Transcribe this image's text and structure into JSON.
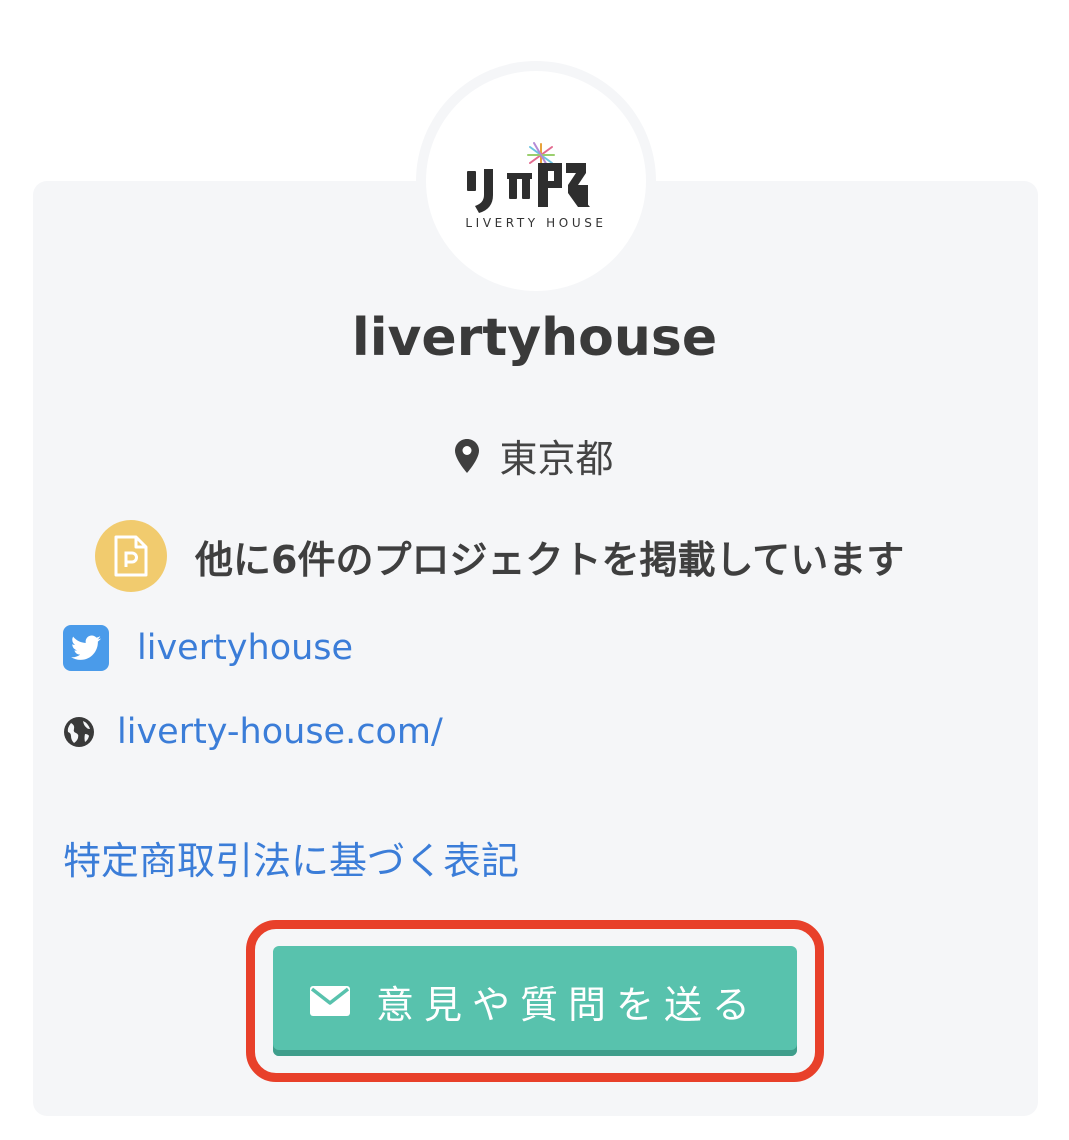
{
  "profile": {
    "avatar_logo_text": "LIVERTY HOUSE",
    "username": "livertyhouse",
    "location": "東京都",
    "projects_text": "他に6件のプロジェクトを掲載しています",
    "twitter_handle": "livertyhouse",
    "website": "liverty-house.com/",
    "law_link": "特定商取引法に基づく表記",
    "send_button_label": "意見や質問を送る"
  },
  "colors": {
    "link": "#3b7dd8",
    "button": "#58c2ad",
    "highlight_border": "#e8402a",
    "badge": "#f1cb6e",
    "twitter": "#4a9bea"
  },
  "icons": {
    "location": "map-pin-icon",
    "projects": "project-document-icon",
    "twitter": "twitter-icon",
    "website": "globe-icon",
    "send": "envelope-icon"
  }
}
